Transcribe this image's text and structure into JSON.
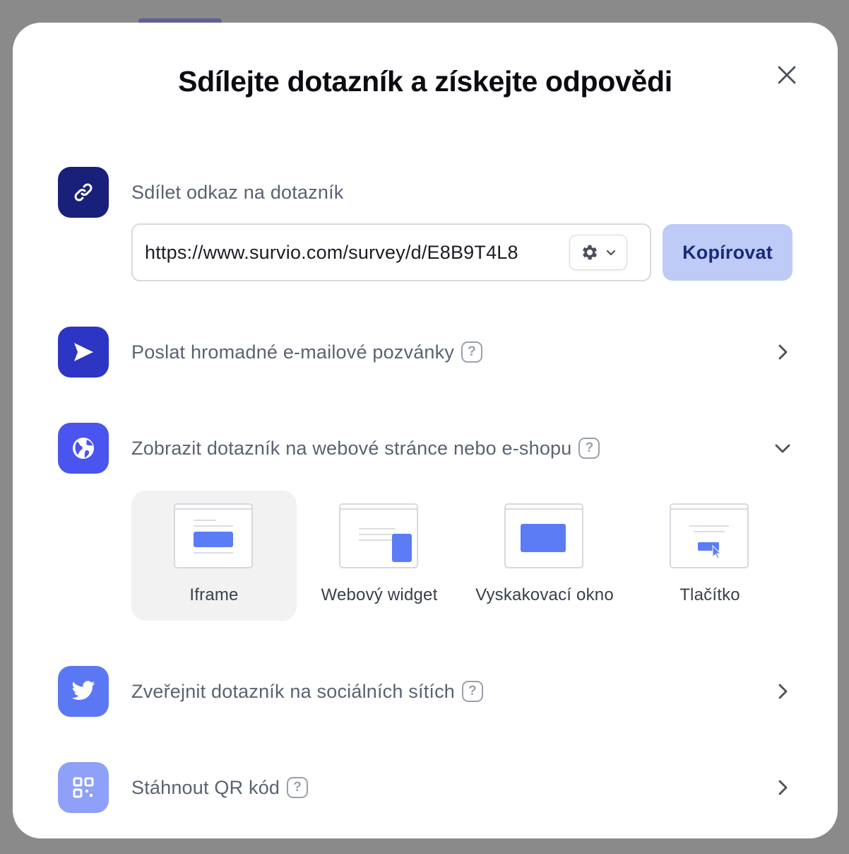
{
  "modal": {
    "title": "Sdílejte dotazník a získejte odpovědi",
    "close_icon": "close-icon"
  },
  "share_link": {
    "label": "Sdílet odkaz na dotazník",
    "icon": "link-icon",
    "icon_color": "#18207a",
    "url": "https://www.survio.com/survey/d/E8B9T4L8",
    "settings_icon": "gear-icon",
    "copy_label": "Kopírovat",
    "copy_color": "#bfcbf7"
  },
  "email": {
    "label": "Poslat hromadné e-mailové pozvánky",
    "icon": "send-icon",
    "icon_color": "#2c35c4"
  },
  "website": {
    "label": "Zobrazit dotazník na webové stránce nebo e-shopu",
    "icon": "globe-icon",
    "icon_color": "#4a54ee",
    "expanded": true,
    "options": [
      {
        "label": "Iframe",
        "selected": true
      },
      {
        "label": "Webový widget",
        "selected": false
      },
      {
        "label": "Vyskakovací okno",
        "selected": false
      },
      {
        "label": "Tlačítko",
        "selected": false
      }
    ]
  },
  "social": {
    "label": "Zveřejnit dotazník na sociálních sítích",
    "icon": "twitter-icon",
    "icon_color": "#5b78f4"
  },
  "qr": {
    "label": "Stáhnout QR kód",
    "icon": "qr-code-icon",
    "icon_color": "#8ea0f7"
  },
  "help_mark": "?"
}
